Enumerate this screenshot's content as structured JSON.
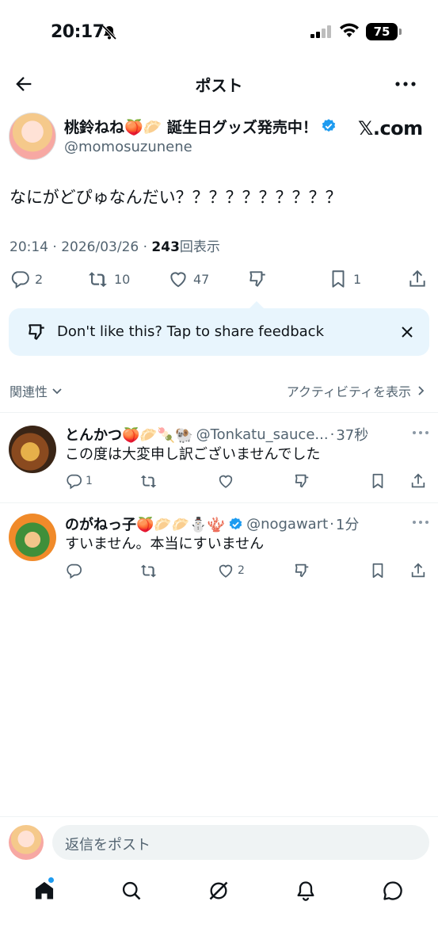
{
  "status_bar": {
    "time": "20:17",
    "battery": "75"
  },
  "header": {
    "title": "ポスト"
  },
  "post": {
    "display_name": "桃鈴ねね🍑🥟 誕生日グッズ発売中！",
    "handle": "@momosuzunene",
    "brand": "𝕏.com",
    "text": "なにがどぴゅなんだい？？？？？？？？？？",
    "time": "20:14",
    "date": "2026/03/26",
    "views": "243",
    "views_label": "回表示",
    "counts": {
      "replies": "2",
      "reposts": "10",
      "likes": "47",
      "bookmarks": "1"
    }
  },
  "feedback": {
    "text": "Don't like this? Tap to share feedback"
  },
  "sort": {
    "label": "関連性",
    "activity_label": "アクティビティを表示"
  },
  "replies": [
    {
      "name": "とんかつ🍑🥟🍡🐏",
      "handle": "@Tonkatu_sauce...",
      "time": "37秒",
      "text": "この度は大変申し訳ございませんでした",
      "counts": {
        "replies": "1",
        "reposts": "",
        "likes": ""
      }
    },
    {
      "name": "のがねっ子🍑🥟🥟⛄🪸",
      "handle": "@nogawart",
      "time": "1分",
      "text": "すいません。本当にすいません",
      "counts": {
        "replies": "",
        "reposts": "",
        "likes": "2"
      }
    }
  ],
  "composer": {
    "placeholder": "返信をポスト"
  },
  "colors": {
    "accent": "#1d9bf0",
    "secondary_text": "#536471",
    "banner_bg": "#e8f5fd"
  },
  "icons": [
    "back-arrow-icon",
    "more-icon",
    "verified-badge-icon",
    "reply-icon",
    "repost-icon",
    "like-icon",
    "dislike-icon",
    "bookmark-icon",
    "share-icon",
    "close-icon",
    "home-icon",
    "search-icon",
    "grok-icon",
    "notifications-icon",
    "messages-icon"
  ]
}
